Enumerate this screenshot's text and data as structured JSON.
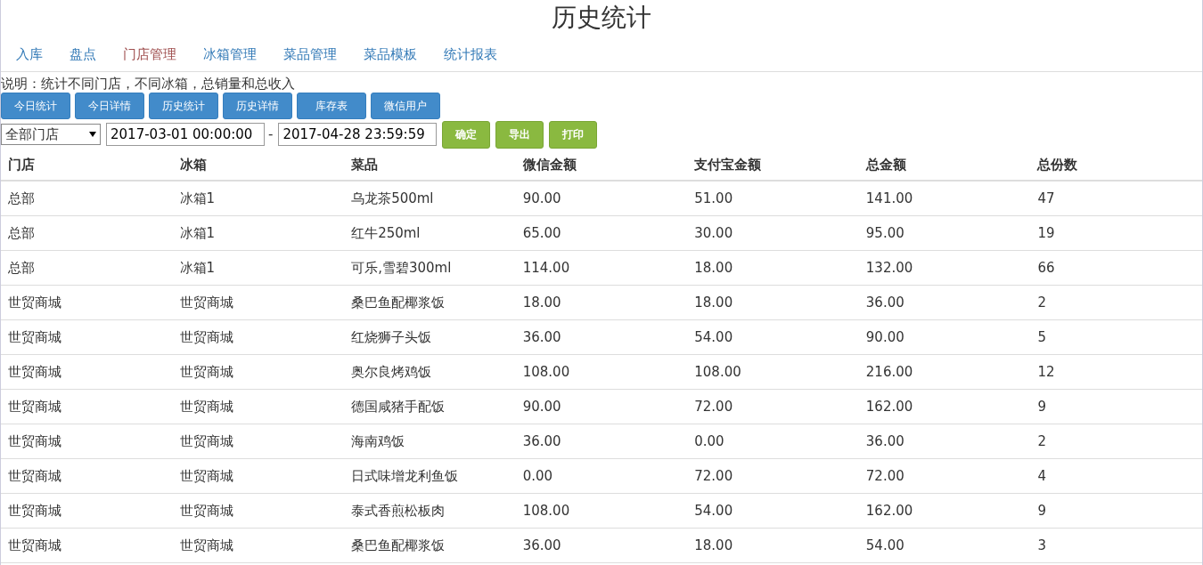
{
  "title": "历史统计",
  "nav": [
    {
      "label": "入库",
      "selected": false
    },
    {
      "label": "盘点",
      "selected": false
    },
    {
      "label": "门店管理",
      "selected": true
    },
    {
      "label": "冰箱管理",
      "selected": false
    },
    {
      "label": "菜品管理",
      "selected": false
    },
    {
      "label": "菜品模板",
      "selected": false
    },
    {
      "label": "统计报表",
      "selected": false
    }
  ],
  "description": "说明：统计不同门店，不同冰箱，总销量和总收入",
  "report_buttons": [
    "今日统计",
    "今日详情",
    "历史统计",
    "历史详情",
    "库存表",
    "微信用户"
  ],
  "filter": {
    "store": "全部门店",
    "start": "2017-03-01 00:00:00",
    "separator": "-",
    "end": "2017-04-28 23:59:59",
    "actions": [
      "确定",
      "导出",
      "打印"
    ]
  },
  "table": {
    "columns": [
      "门店",
      "冰箱",
      "菜品",
      "微信金额",
      "支付宝金额",
      "总金额",
      "总份数"
    ],
    "rows": [
      [
        "总部",
        "冰箱1",
        "乌龙茶500ml",
        "90.00",
        "51.00",
        "141.00",
        "47"
      ],
      [
        "总部",
        "冰箱1",
        "红牛250ml",
        "65.00",
        "30.00",
        "95.00",
        "19"
      ],
      [
        "总部",
        "冰箱1",
        "可乐,雪碧300ml",
        "114.00",
        "18.00",
        "132.00",
        "66"
      ],
      [
        "世贸商城",
        "世贸商城",
        "桑巴鱼配椰浆饭",
        "18.00",
        "18.00",
        "36.00",
        "2"
      ],
      [
        "世贸商城",
        "世贸商城",
        "红烧狮子头饭",
        "36.00",
        "54.00",
        "90.00",
        "5"
      ],
      [
        "世贸商城",
        "世贸商城",
        "奥尔良烤鸡饭",
        "108.00",
        "108.00",
        "216.00",
        "12"
      ],
      [
        "世贸商城",
        "世贸商城",
        "德国咸猪手配饭",
        "90.00",
        "72.00",
        "162.00",
        "9"
      ],
      [
        "世贸商城",
        "世贸商城",
        "海南鸡饭",
        "36.00",
        "0.00",
        "36.00",
        "2"
      ],
      [
        "世贸商城",
        "世贸商城",
        "日式味增龙利鱼饭",
        "0.00",
        "72.00",
        "72.00",
        "4"
      ],
      [
        "世贸商城",
        "世贸商城",
        "泰式香煎松板肉",
        "108.00",
        "54.00",
        "162.00",
        "9"
      ],
      [
        "世贸商城",
        "世贸商城",
        "桑巴鱼配椰浆饭",
        "36.00",
        "18.00",
        "54.00",
        "3"
      ]
    ]
  }
}
